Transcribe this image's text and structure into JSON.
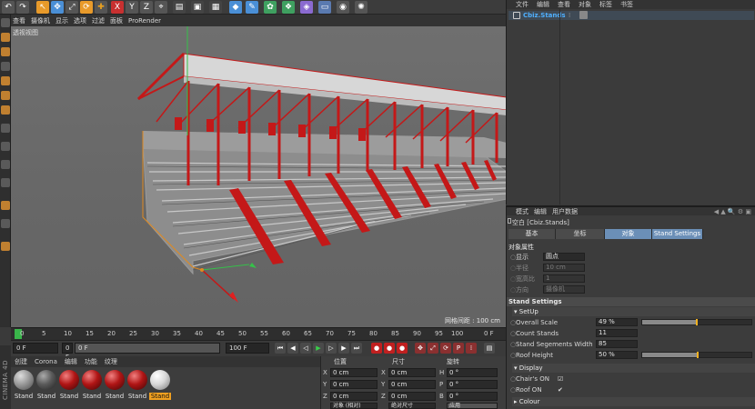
{
  "toolbar": {
    "icons": [
      "undo-icon",
      "redo-icon",
      "select-icon",
      "move-icon",
      "scale-icon",
      "rotate-icon",
      "add-icon",
      "x-axis-icon",
      "y-axis-icon",
      "z-axis-icon",
      "world-axis-icon",
      "render-region-icon",
      "render-view-icon",
      "render-settings-icon",
      "cube-icon",
      "spline-icon",
      "nurbs-icon",
      "array-icon",
      "deformer-icon",
      "floor-icon",
      "camera-icon",
      "light-icon"
    ],
    "axis_labels": [
      "X",
      "Y",
      "Z"
    ]
  },
  "viewport": {
    "menu": [
      "查看",
      "摄像机",
      "显示",
      "选项",
      "过滤",
      "面板",
      "ProRender"
    ],
    "title": "透视视图",
    "grid_note": "网格间距 : 100 cm"
  },
  "timeline": {
    "ticks": [
      "0",
      "5",
      "10",
      "15",
      "20",
      "25",
      "30",
      "35",
      "40",
      "45",
      "50",
      "55",
      "60",
      "65",
      "70",
      "75",
      "80",
      "85",
      "90",
      "95",
      "100"
    ],
    "end_label": "0 F",
    "current_frame": "0 F",
    "start_field": "0 F",
    "min_field": "0 F",
    "max_field": "100 F",
    "end_field": "100 F"
  },
  "materials": {
    "menu": [
      "创建",
      "Corona",
      "编辑",
      "功能",
      "纹理"
    ],
    "items": [
      {
        "label": "Stand",
        "color": "#9a9a9a"
      },
      {
        "label": "Stand",
        "color": "#5a5a5a"
      },
      {
        "label": "Stand",
        "color": "#b01515"
      },
      {
        "label": "Stand",
        "color": "#b01515"
      },
      {
        "label": "Stand",
        "color": "#b01515"
      },
      {
        "label": "Stand",
        "color": "#b01515"
      },
      {
        "label": "Stand",
        "color": "#e8e8e8"
      }
    ]
  },
  "coords": {
    "headers": [
      "位置",
      "尺寸",
      "旋转"
    ],
    "rows": [
      {
        "a": "X",
        "pos": "0 cm",
        "b": "X",
        "size": "0 cm",
        "c": "H",
        "rot": "0 °"
      },
      {
        "a": "Y",
        "pos": "0 cm",
        "b": "Y",
        "size": "0 cm",
        "c": "P",
        "rot": "0 °"
      },
      {
        "a": "Z",
        "pos": "0 cm",
        "b": "Z",
        "size": "0 cm",
        "c": "B",
        "rot": "0 °"
      }
    ],
    "footer": [
      "对象 (相对)",
      "绝对尺寸",
      "应用"
    ]
  },
  "object_manager": {
    "menu": [
      "文件",
      "编辑",
      "查看",
      "对象",
      "标签",
      "书签"
    ],
    "object_name": "Cbiz.Stands"
  },
  "attributes": {
    "menu": [
      "模式",
      "编辑",
      "用户数据"
    ],
    "title": "空白 [Cbiz.Stands]",
    "tabs": [
      "基本",
      "坐标",
      "对象",
      "Stand Settings"
    ],
    "object_props_header": "对象属性",
    "display": {
      "label": "显示",
      "value": "圆点"
    },
    "radius": {
      "label": "半径",
      "value": "10 cm"
    },
    "aspect": {
      "label": "宽高比",
      "value": "1"
    },
    "orientation": {
      "label": "方向",
      "value": "摄像机"
    },
    "stand_settings_header": "Stand Settings",
    "setup_header": "SetUp",
    "overall_scale": {
      "label": "Overall Scale",
      "value": "49 %",
      "level": 0.49
    },
    "count_stands": {
      "label": "Count Stands",
      "value": "11"
    },
    "segments_width": {
      "label": "Stand Segements Width",
      "value": "85"
    },
    "roof_height": {
      "label": "Roof Height",
      "value": "50 %",
      "level": 0.5
    },
    "display_header": "Display",
    "chairs_on": {
      "label": "Chair's ON",
      "value": "☑"
    },
    "roof_on": {
      "label": "Roof ON",
      "value": "✔"
    },
    "colour_header": "Colour"
  }
}
